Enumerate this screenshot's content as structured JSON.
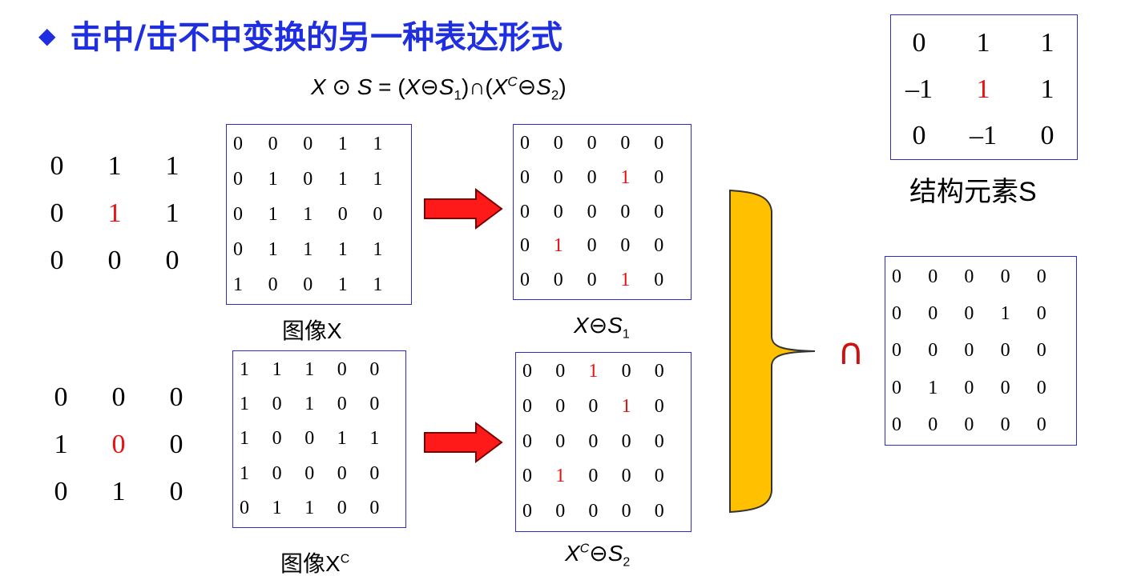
{
  "title": "击中/击不中变换的另一种表达形式",
  "formula": {
    "X": "X",
    "odot": "⊙",
    "S": "S",
    "eq": " = (",
    "X2": "X",
    "ominus": "⊖",
    "S1": "S",
    "s1sub": "1",
    "cap": ")∩(",
    "X3": "X",
    "xc": "C",
    "ominus2": "⊖",
    "S2": "S",
    "s2sub": "2",
    "close": ")"
  },
  "se": {
    "label": "结构元素S",
    "cells": [
      "0",
      "1",
      "1",
      "–1",
      "1",
      "1",
      "0",
      "–1",
      "0"
    ],
    "red": [
      4
    ]
  },
  "hit_kernel": {
    "cells": [
      "0",
      "1",
      "1",
      "0",
      "1",
      "1",
      "0",
      "0",
      "0"
    ],
    "red": [
      4
    ]
  },
  "miss_kernel": {
    "cells": [
      "0",
      "0",
      "0",
      "1",
      "0",
      "0",
      "0",
      "1",
      "0"
    ],
    "red": [
      4
    ]
  },
  "image_x": {
    "label": "图像X",
    "cells": [
      "0",
      "0",
      "0",
      "1",
      "1",
      "0",
      "1",
      "0",
      "1",
      "1",
      "0",
      "1",
      "1",
      "0",
      "0",
      "0",
      "1",
      "1",
      "1",
      "1",
      "1",
      "0",
      "0",
      "1",
      "1"
    ]
  },
  "image_xc": {
    "label": "图像X",
    "sup": "C",
    "cells": [
      "1",
      "1",
      "1",
      "0",
      "0",
      "1",
      "0",
      "1",
      "0",
      "0",
      "1",
      "0",
      "0",
      "1",
      "1",
      "1",
      "0",
      "0",
      "0",
      "0",
      "0",
      "1",
      "1",
      "0",
      "0"
    ]
  },
  "erode1": {
    "lx": "X",
    "lop": "⊖",
    "ls": "S",
    "lsub": "1",
    "cells": [
      "0",
      "0",
      "0",
      "0",
      "0",
      "0",
      "0",
      "0",
      "1",
      "0",
      "0",
      "0",
      "0",
      "0",
      "0",
      "0",
      "1",
      "0",
      "0",
      "0",
      "0",
      "0",
      "0",
      "1",
      "0"
    ],
    "red": [
      8,
      16,
      23
    ]
  },
  "erode2": {
    "lx": "X",
    "lsup": "C",
    "lop": "⊖",
    "ls": "S",
    "lsub": "2",
    "cells": [
      "0",
      "0",
      "1",
      "0",
      "0",
      "0",
      "0",
      "0",
      "1",
      "0",
      "0",
      "0",
      "0",
      "0",
      "0",
      "0",
      "1",
      "0",
      "0",
      "0",
      "0",
      "0",
      "0",
      "0",
      "0"
    ],
    "red": [
      2,
      8,
      16
    ]
  },
  "result": {
    "cells": [
      "0",
      "0",
      "0",
      "0",
      "0",
      "0",
      "0",
      "0",
      "1",
      "0",
      "0",
      "0",
      "0",
      "0",
      "0",
      "0",
      "1",
      "0",
      "0",
      "0",
      "0",
      "0",
      "0",
      "0",
      "0"
    ]
  },
  "intersect_symbol": "∩",
  "colors": {
    "title": "#1f2fe0",
    "frame": "#2b2bd0",
    "arrow": "#ff1a1a",
    "brace": "#ffc000",
    "highlight": "#e81010"
  }
}
